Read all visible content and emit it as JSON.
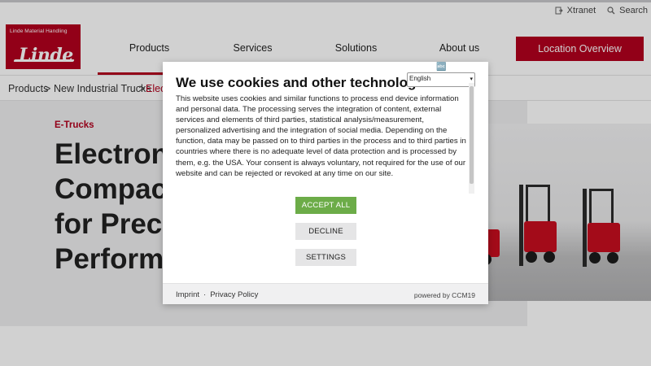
{
  "topbar": {
    "xtranet_label": "Xtranet",
    "search_label": "Search"
  },
  "logo": {
    "subtitle": "Linde Material Handling",
    "wordmark": "Linde"
  },
  "nav": {
    "items": [
      "Products",
      "Services",
      "Solutions",
      "About us"
    ],
    "location_button": "Location Overview"
  },
  "breadcrumb": {
    "items": [
      "Products",
      "New Industrial Trucks",
      "Elec"
    ],
    "separator": ">"
  },
  "hero": {
    "kicker": "E-Trucks",
    "title_lines": [
      "Electroni",
      "Compact",
      "for Precis",
      "Performa"
    ]
  },
  "cookie_modal": {
    "title": "We use cookies and other technologies.",
    "language": "English",
    "body": "This website uses cookies and similar functions to process end device information and personal data. The processing serves the integration of content, external services and elements of third parties, statistical analysis/measurement, personalized advertising and the integration of social media. Depending on the function, data may be passed on to third parties in the process and to third parties in countries where there is no adequate level of data protection and is processed by them, e.g. the USA. Your consent is always voluntary, not required for the use of our website and can be rejected or revoked at any time on our site.",
    "accept_label": "ACCEPT ALL",
    "decline_label": "DECLINE",
    "settings_label": "SETTINGS",
    "imprint_label": "Imprint",
    "footer_separator": "·",
    "privacy_label": "Privacy Policy",
    "powered_by": "powered by CCM19"
  },
  "colors": {
    "brand_red": "#b3001e",
    "accept_green": "#6cac48"
  }
}
